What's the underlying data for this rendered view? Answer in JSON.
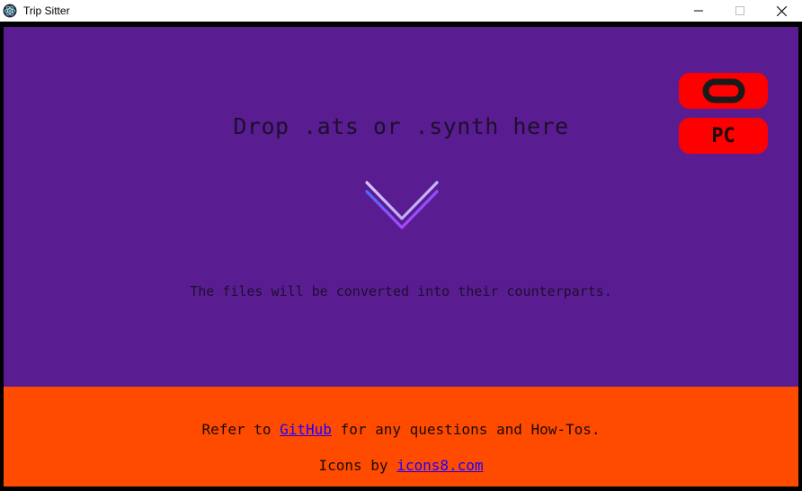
{
  "window": {
    "title": "Trip Sitter",
    "controls": [
      "minimize-icon",
      "maximize-icon",
      "close-icon"
    ]
  },
  "drop_zone": {
    "title": "Drop .ats or .synth here",
    "subtitle": "The files will be converted into their counterparts.",
    "arrow_icon": "chevron-down-icon"
  },
  "platforms": {
    "quest": {
      "icon": "oculus-icon"
    },
    "pc": {
      "label": "PC"
    }
  },
  "footer": {
    "line1_prefix": "Refer to ",
    "github_link": "GitHub",
    "line1_suffix": " for any questions and How-Tos.",
    "line2_prefix": "Icons by ",
    "icons_link": "icons8.com"
  },
  "colors": {
    "drop_zone_bg": "#5a1d91",
    "footer_bg": "#ff4b00",
    "button_bg": "#ff0000",
    "link": "#1d00ff"
  }
}
